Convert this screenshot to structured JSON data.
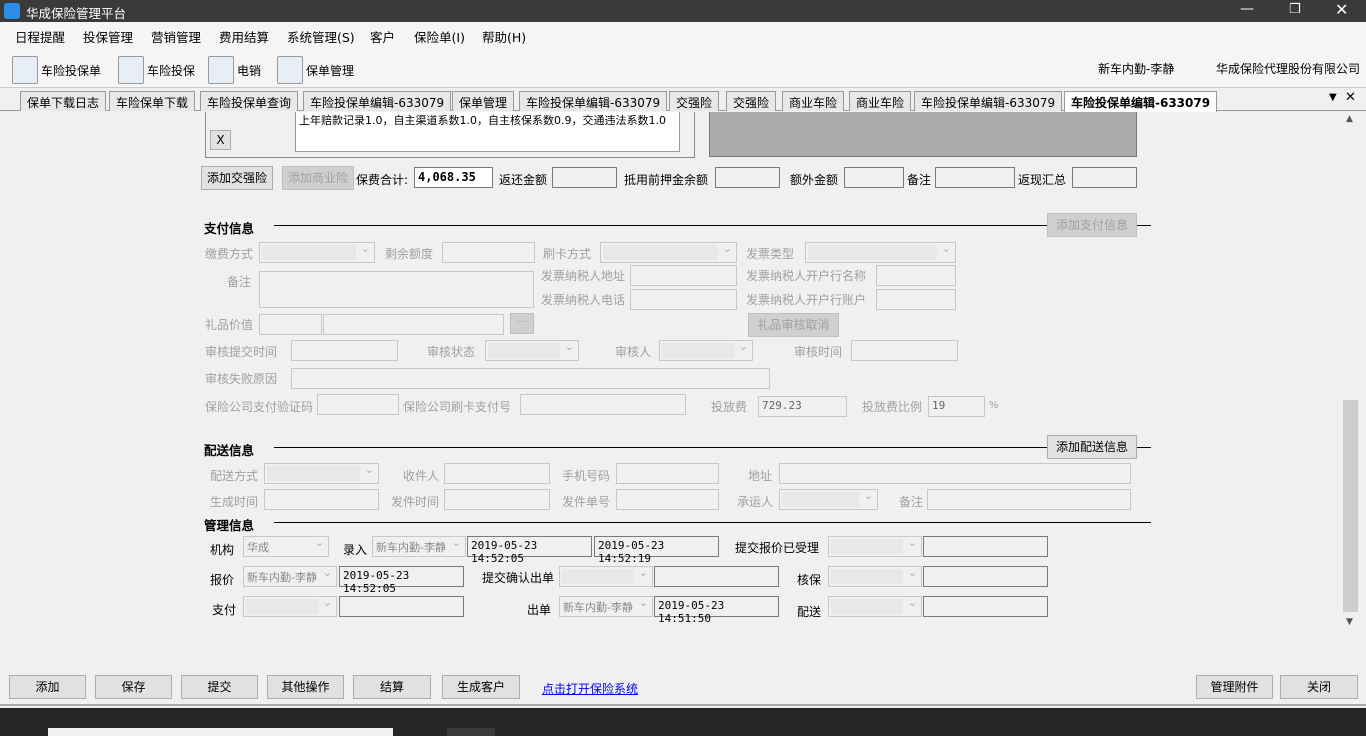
{
  "window": {
    "title": "华成保险管理平台"
  },
  "menu": [
    "日程提醒",
    "投保管理",
    "营销管理",
    "费用结算",
    "系统管理(S)",
    "客户",
    "保险单(I)",
    "帮助(H)"
  ],
  "toolbar": {
    "items": [
      "车险投保单",
      "车险投保",
      "电销",
      "保单管理"
    ],
    "user": "新车内勤-李静",
    "company": "华成保险代理股份有限公司"
  },
  "tabs": [
    "保单下载日志",
    "车险保单下载",
    "车险投保单查询",
    "车险投保单编辑-633079",
    "保单管理",
    "车险投保单编辑-633079",
    "交强险",
    "交强险",
    "商业车险",
    "商业车险",
    "车险投保单编辑-633079",
    "车险投保单编辑-633079"
  ],
  "top": {
    "remark_text": "上年赔款记录1.0，自主渠道系数1.0，自主核保系数0.9，交通违法系数1.0",
    "close_x": "X",
    "add_jqx": "添加交强险",
    "add_syx": "添加商业险",
    "total_label": "保费合计:",
    "total_value": "4,068.35",
    "refund_label": "返还金额",
    "deposit_label": "抵用前押金余额",
    "extra_label": "额外金额",
    "note_label": "备注",
    "cashback_label": "返现汇总"
  },
  "payment": {
    "title": "支付信息",
    "add_btn": "添加支付信息",
    "pay_method": "缴费方式",
    "remaining": "剩余额度",
    "card_method": "刷卡方式",
    "invoice_type": "发票类型",
    "note": "备注",
    "taxpayer_addr": "发票纳税人地址",
    "taxpayer_bank": "发票纳税人开户行名称",
    "taxpayer_phone": "发票纳税人电话",
    "taxpayer_account": "发票纳税人开户行账户",
    "gift_value": "礼品价值",
    "ellipsis": "···",
    "gift_cancel": "礼品审核取消",
    "audit_submit": "审核提交时间",
    "audit_status": "审核状态",
    "auditor": "审核人",
    "audit_time": "审核时间",
    "audit_fail": "审核失败原因",
    "verify_code": "保险公司支付验证码",
    "card_pay_no": "保险公司刷卡支付号",
    "fee_label": "投放费",
    "fee_value": "729.23",
    "fee_ratio_label": "投放费比例",
    "fee_ratio_value": "19",
    "percent": "%"
  },
  "delivery": {
    "title": "配送信息",
    "add_btn": "添加配送信息",
    "method": "配送方式",
    "receiver": "收件人",
    "phone": "手机号码",
    "address": "地址",
    "gen_time": "生成时间",
    "send_time": "发件时间",
    "send_no": "发件单号",
    "carrier": "承运人",
    "note": "备注"
  },
  "mgmt": {
    "title": "管理信息",
    "org_label": "机构",
    "org_value": "华成",
    "entry_label": "录入",
    "entry_user": "新车内勤-李静",
    "entry_time1": "2019-05-23 14:52:05",
    "entry_time2": "2019-05-23 14:52:19",
    "quote_accepted": "提交报价已受理",
    "quote_label": "报价",
    "quote_user": "新车内勤-李静",
    "quote_time": "2019-05-23 14:52:05",
    "confirm_issue": "提交确认出单",
    "underwrite": "核保",
    "pay_label": "支付",
    "issue_label": "出单",
    "issue_user": "新车内勤-李静",
    "issue_time": "2019-05-23 14:51:50",
    "deliver_label": "配送"
  },
  "bottom": {
    "add": "添加",
    "save": "保存",
    "submit": "提交",
    "other": "其他操作",
    "settle": "结算",
    "gen_customer": "生成客户",
    "open_link": "点击打开保险系统",
    "attachments": "管理附件",
    "close": "关闭"
  }
}
